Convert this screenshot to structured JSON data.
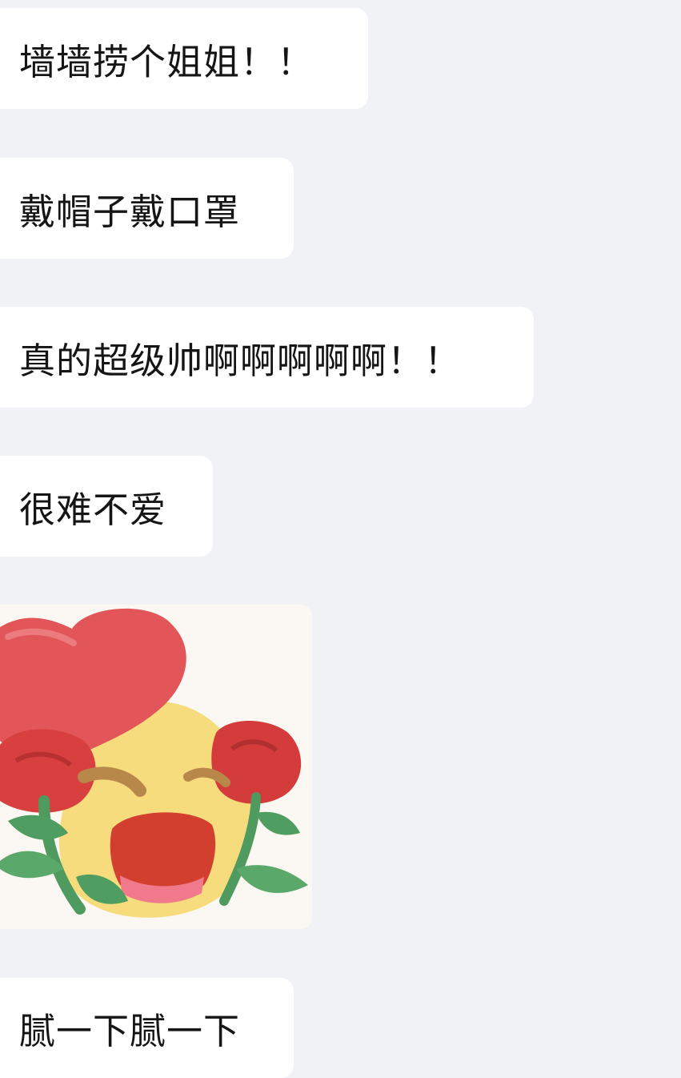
{
  "messages": [
    {
      "type": "text",
      "text": "墙墙捞个姐姐！！"
    },
    {
      "type": "text",
      "text": "戴帽子戴口罩"
    },
    {
      "type": "text",
      "text": "真的超级帅啊啊啊啊啊！！"
    },
    {
      "type": "text",
      "text": "很难不爱"
    },
    {
      "type": "sticker",
      "icon": "heart-roses-sticker-icon"
    },
    {
      "type": "text",
      "text": "腻一下腻一下"
    }
  ],
  "colors": {
    "background": "#f1f2f6",
    "bubble": "#ffffff",
    "text": "#151515"
  }
}
